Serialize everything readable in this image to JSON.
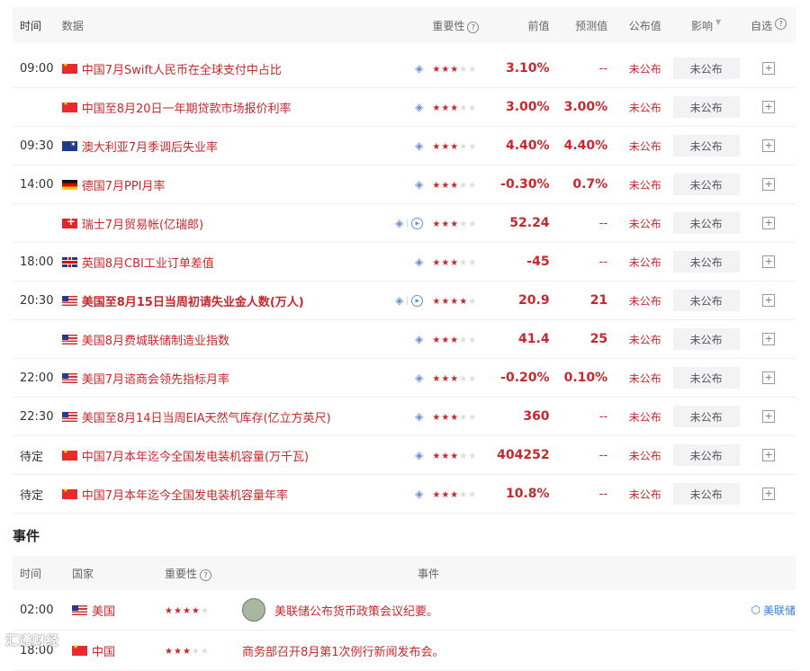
{
  "header": {
    "time": "时间",
    "data": "数据",
    "importance": "重要性",
    "previous": "前值",
    "forecast": "预测值",
    "published": "公布值",
    "effect": "影响",
    "favorite": "自选"
  },
  "rows": [
    {
      "time": "09:00",
      "flag": "cn",
      "name": "中国7月Swift人民币在全球支付中占比",
      "stars": 3,
      "prev": "3.10%",
      "forecast": "--",
      "published": "未公布",
      "effect": "未公布",
      "bold": false,
      "video": false
    },
    {
      "time": "",
      "flag": "cn",
      "name": "中国至8月20日一年期贷款市场报价利率",
      "stars": 3,
      "prev": "3.00%",
      "forecast": "3.00%",
      "published": "未公布",
      "effect": "未公布",
      "bold": false,
      "video": false
    },
    {
      "time": "09:30",
      "flag": "au",
      "name": "澳大利亚7月季调后失业率",
      "stars": 3,
      "prev": "4.40%",
      "forecast": "4.40%",
      "published": "未公布",
      "effect": "未公布",
      "bold": false,
      "video": false
    },
    {
      "time": "14:00",
      "flag": "de",
      "name": "德国7月PPI月率",
      "stars": 3,
      "prev": "-0.30%",
      "forecast": "0.7%",
      "published": "未公布",
      "effect": "未公布",
      "bold": false,
      "video": false
    },
    {
      "time": "",
      "flag": "ch",
      "name": "瑞士7月贸易帐(亿瑞郎)",
      "stars": 3,
      "prev": "52.24",
      "forecast": "--",
      "published": "未公布",
      "effect": "未公布",
      "bold": false,
      "video": true
    },
    {
      "time": "18:00",
      "flag": "gb",
      "name": "英国8月CBI工业订单差值",
      "stars": 3,
      "prev": "-45",
      "forecast": "--",
      "published": "未公布",
      "effect": "未公布",
      "bold": false,
      "video": false
    },
    {
      "time": "20:30",
      "flag": "us",
      "name": "美国至8月15日当周初请失业金人数(万人)",
      "stars": 4,
      "prev": "20.9",
      "forecast": "21",
      "published": "未公布",
      "effect": "未公布",
      "bold": true,
      "video": true
    },
    {
      "time": "",
      "flag": "us",
      "name": "美国8月费城联储制造业指数",
      "stars": 3,
      "prev": "41.4",
      "forecast": "25",
      "published": "未公布",
      "effect": "未公布",
      "bold": false,
      "video": false
    },
    {
      "time": "22:00",
      "flag": "us",
      "name": "美国7月谘商会领先指标月率",
      "stars": 3,
      "prev": "-0.20%",
      "forecast": "0.10%",
      "published": "未公布",
      "effect": "未公布",
      "bold": false,
      "video": false
    },
    {
      "time": "22:30",
      "flag": "us",
      "name": "美国至8月14日当周EIA天然气库存(亿立方英尺)",
      "stars": 3,
      "prev": "360",
      "forecast": "--",
      "published": "未公布",
      "effect": "未公布",
      "bold": false,
      "video": false
    },
    {
      "time": "待定",
      "flag": "cn",
      "name": "中国7月本年迄今全国发电装机容量(万千瓦)",
      "stars": 3,
      "prev": "404252",
      "forecast": "--",
      "published": "未公布",
      "effect": "未公布",
      "bold": false,
      "video": false
    },
    {
      "time": "待定",
      "flag": "cn",
      "name": "中国7月本年迄今全国发电装机容量年率",
      "stars": 3,
      "prev": "10.8%",
      "forecast": "--",
      "published": "未公布",
      "effect": "未公布",
      "bold": false,
      "video": false
    }
  ],
  "events": {
    "title": "事件",
    "header": {
      "time": "时间",
      "country": "国家",
      "importance": "重要性",
      "event": "事件"
    },
    "rows": [
      {
        "time": "02:00",
        "flag": "us",
        "country": "美国",
        "stars": 4,
        "event": "美联储公布货币政策会议纪要。",
        "link": "美联储",
        "seal": true
      },
      {
        "time": "18:00",
        "flag": "cn",
        "country": "中国",
        "stars": 3,
        "event": "商务部召开8月第1次例行新闻发布会。",
        "link": "",
        "seal": false
      }
    ]
  },
  "watermark": "汇通财经"
}
